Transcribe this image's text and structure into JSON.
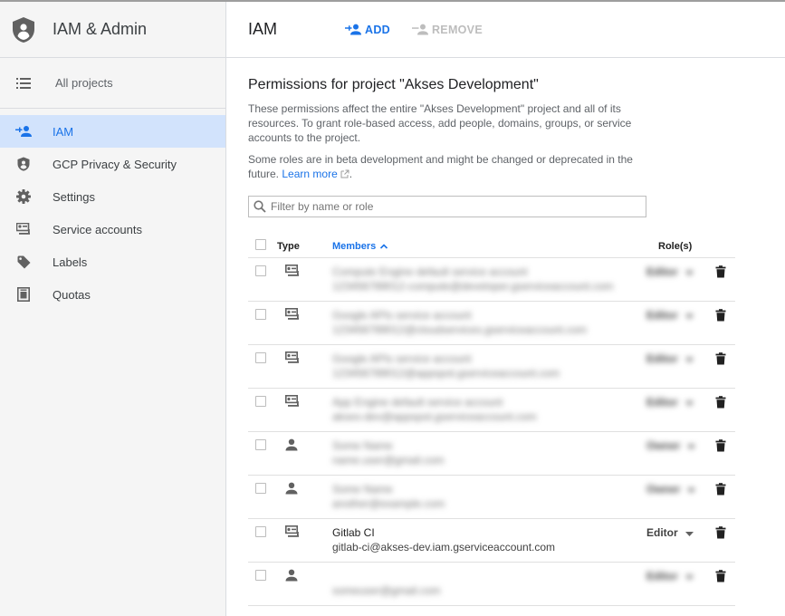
{
  "sidebar": {
    "title": "IAM & Admin",
    "all_projects": "All projects",
    "items": [
      {
        "label": "IAM",
        "icon": "person-add-icon",
        "active": true
      },
      {
        "label": "GCP Privacy & Security",
        "icon": "shield-icon",
        "active": false
      },
      {
        "label": "Settings",
        "icon": "gear-icon",
        "active": false
      },
      {
        "label": "Service accounts",
        "icon": "service-account-icon",
        "active": false
      },
      {
        "label": "Labels",
        "icon": "tag-icon",
        "active": false
      },
      {
        "label": "Quotas",
        "icon": "quota-icon",
        "active": false
      }
    ]
  },
  "topbar": {
    "title": "IAM",
    "add_label": "ADD",
    "remove_label": "REMOVE"
  },
  "content": {
    "heading": "Permissions for project \"Akses Development\"",
    "description": "These permissions affect the entire \"Akses Development\" project and all of its resources. To grant role-based access, add people, domains, groups, or service accounts to the project.",
    "beta_note": "Some roles are in beta development and might be changed or deprecated in the future.",
    "learn_more": "Learn more",
    "filter_placeholder": "Filter by name or role"
  },
  "table": {
    "col_type": "Type",
    "col_members": "Members",
    "col_roles": "Role(s)",
    "rows": [
      {
        "type": "service-account",
        "name": "Compute Engine default service account",
        "email": "123456789012-compute@developer.gserviceaccount.com",
        "role": "Editor",
        "blurred": true
      },
      {
        "type": "service-account",
        "name": "Google APIs service account",
        "email": "123456789012@cloudservices.gserviceaccount.com",
        "role": "Editor",
        "blurred": true
      },
      {
        "type": "service-account",
        "name": "Google APIs service account",
        "email": "123456789012@appspot.gserviceaccount.com",
        "role": "Editor",
        "blurred": true
      },
      {
        "type": "service-account",
        "name": "App Engine default service account",
        "email": "akses-dev@appspot.gserviceaccount.com",
        "role": "Editor",
        "blurred": true
      },
      {
        "type": "person",
        "name": "Some Name",
        "email": "name.user@gmail.com",
        "role": "Owner",
        "blurred": true
      },
      {
        "type": "person",
        "name": "Some Name",
        "email": "another@example.com",
        "role": "Owner",
        "blurred": true
      },
      {
        "type": "service-account",
        "name": "Gitlab CI",
        "email": "gitlab-ci@akses-dev.iam.gserviceaccount.com",
        "role": "Editor",
        "blurred": false
      },
      {
        "type": "person",
        "name": "",
        "email": "someuser@gmail.com",
        "role": "Editor",
        "blurred": true
      }
    ]
  },
  "colors": {
    "accent": "#1a73e8",
    "sidebar_bg": "#f5f5f5",
    "active_bg": "#d2e3fc"
  }
}
